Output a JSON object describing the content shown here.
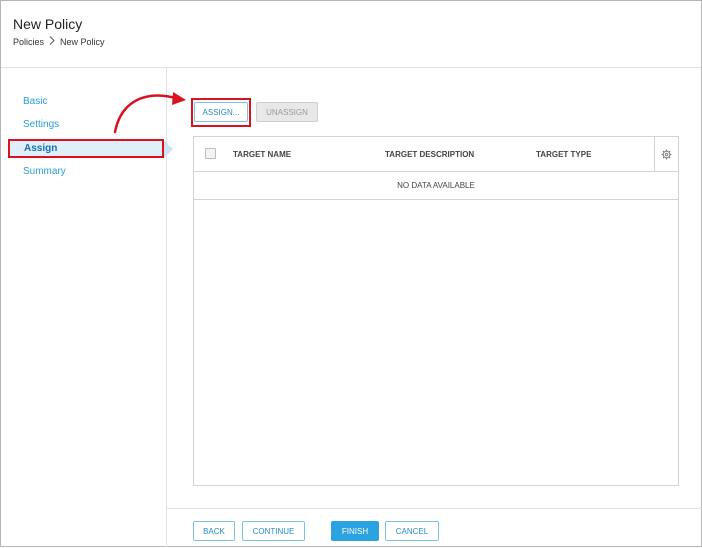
{
  "header": {
    "title": "New Policy",
    "breadcrumb": [
      "Policies",
      "New Policy"
    ]
  },
  "sidebar": {
    "items": [
      {
        "label": "Basic",
        "active": false
      },
      {
        "label": "Settings",
        "active": false
      },
      {
        "label": "Assign",
        "active": true
      },
      {
        "label": "Summary",
        "active": false
      }
    ]
  },
  "toolbar": {
    "assign_label": "ASSIGN...",
    "unassign_label": "UNASSIGN",
    "unassign_disabled": true
  },
  "grid": {
    "columns": [
      "TARGET NAME",
      "TARGET DESCRIPTION",
      "TARGET TYPE"
    ],
    "rows": [],
    "empty_text": "NO DATA AVAILABLE"
  },
  "footer": {
    "back_label": "BACK",
    "continue_label": "CONTINUE",
    "finish_label": "FINISH",
    "cancel_label": "CANCEL"
  },
  "icons": {
    "breadcrumb_separator": "chevron-right-icon",
    "grid_settings": "gear-icon"
  },
  "colors": {
    "accent": "#2ba3e0",
    "link": "#2a9fd6",
    "highlight": "#d8131f",
    "active_nav_bg": "#dff0fa"
  }
}
